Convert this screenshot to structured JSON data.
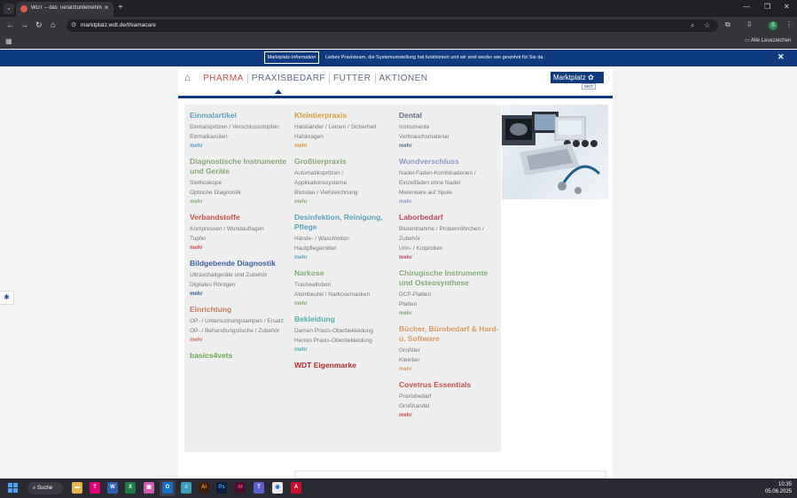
{
  "browser": {
    "tab_title": "WDT – das Tierarztuntemehmen",
    "url": "marktplatz.wdt.de/thiamacare",
    "bookmarks_folder": "Alle Lesezeichen",
    "profile_initial": "S"
  },
  "infobar": {
    "button_label": "Marktplatz-Information",
    "message": "Liebes Praxisteam, die Systemumstellung hat funktioniert und wir sind wieder wie gewohnt für Sie da."
  },
  "nav": {
    "items": [
      "PHARMA",
      "PRAXISBEDARF",
      "FUTTER",
      "AKTIONEN"
    ],
    "brand": "Marktplatz",
    "brand_sub": "WDT"
  },
  "menu": {
    "columns": [
      [
        {
          "title": "Einmalartikel",
          "color": "#5aa0b9",
          "subs": [
            "Einmalspritzen / Verschlussstopfen",
            "Einmalkanülen"
          ],
          "more": "mehr"
        },
        {
          "title": "Diagnostische Instrumente und Geräte",
          "color": "#84a878",
          "subs": [
            "Stethoskope",
            "Optische Diagnostik"
          ],
          "more": "mehr"
        },
        {
          "title": "Verbandstoffe",
          "color": "#c8504a",
          "subs": [
            "Kompressen / Wundauflagen",
            "Tupfer"
          ],
          "more": "mehr"
        },
        {
          "title": "Bildgebende Diagnostik",
          "color": "#3a5f9e",
          "subs": [
            "Ultraschallgeräte und Zubehör",
            "Digitales Röntgen"
          ],
          "more": "mehr"
        },
        {
          "title": "Einrichtung",
          "color": "#c07a5a",
          "subs": [
            "OP- / Untersuchungslampen / Ersatz",
            "OP- / Behandlungstische / Zubehör"
          ],
          "more": "mehr"
        },
        {
          "title": "basics4vets",
          "color": "#6aa84f",
          "subs": [],
          "more": ""
        }
      ],
      [
        {
          "title": "Kleintierpraxis",
          "color": "#d89a35",
          "subs": [
            "Halsbänder / Leinen / Sicherheit",
            "Halskragen"
          ],
          "more": "mehr"
        },
        {
          "title": "Großtierpraxis",
          "color": "#84a878",
          "subs": [
            "Automatikspritzen / Applikationssysteme",
            "Blutstau / Viehzeichnung"
          ],
          "more": "mehr"
        },
        {
          "title": "Desinfektion, Reinigung, Pflege",
          "color": "#5aa0b9",
          "subs": [
            "Hände- / Waschlotion",
            "Hautpflegemittel"
          ],
          "more": "mehr"
        },
        {
          "title": "Narkose",
          "color": "#84a878",
          "subs": [
            "Trachealtuben",
            "Atembeutel / Narkosemasken"
          ],
          "more": "mehr"
        },
        {
          "title": "Bekleidung",
          "color": "#4db0b0",
          "subs": [
            "Damen Praxis-Oberbekleidung",
            "Herren Praxis-Oberbekleidung"
          ],
          "more": "mehr"
        },
        {
          "title": "WDT Eigenmarke",
          "color": "#b02a2a",
          "subs": [],
          "more": ""
        }
      ],
      [
        {
          "title": "Dental",
          "color": "#5e7083",
          "subs": [
            "Instrumente",
            "Verbrauchsmaterial"
          ],
          "more": "mehr"
        },
        {
          "title": "Wundverschluss",
          "color": "#8899c3",
          "subs": [
            "Nadel-Faden-Kombinationen / Einzelfäden ohne Nadel",
            "Meterware auf Spule"
          ],
          "more": "mehr"
        },
        {
          "title": "Laborbedarf",
          "color": "#b84560",
          "subs": [
            "Blutentnahme / Probenröhrchen / Zubehör",
            "Urin- / Kotproben"
          ],
          "more": "mehr"
        },
        {
          "title": "Chirugische Instrumente und Osteosynthese",
          "color": "#84a878",
          "subs": [
            "DCP-Platten",
            "Platten"
          ],
          "more": "mehr"
        },
        {
          "title": "Bücher, Bürobedarf & Hard- u. Software",
          "color": "#d59a60",
          "subs": [
            "Großtier",
            "Kleintier"
          ],
          "more": "mehr"
        },
        {
          "title": "Covetrus Essentials",
          "color": "#c8504a",
          "subs": [
            "Praxisbedarf",
            "Großhandel"
          ],
          "more": "mehr"
        }
      ]
    ]
  },
  "taskbar": {
    "search_label": "Suche",
    "time": "10:35",
    "date": "05.06.2025"
  }
}
